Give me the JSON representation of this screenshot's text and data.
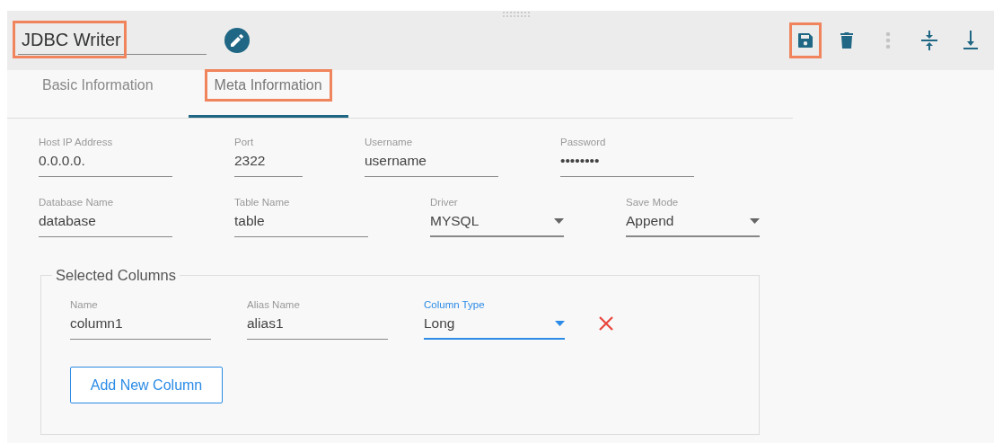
{
  "header": {
    "title": {
      "value": "JDBC Writer",
      "highlighted": true
    },
    "toolbar": [
      {
        "kind": "save",
        "highlighted": true,
        "disabled": false
      },
      {
        "kind": "delete",
        "highlighted": false,
        "disabled": false
      },
      {
        "kind": "more",
        "highlighted": false,
        "disabled": true
      },
      {
        "kind": "collapse",
        "highlighted": false,
        "disabled": false
      },
      {
        "kind": "download",
        "highlighted": false,
        "disabled": false
      }
    ]
  },
  "tabs": [
    {
      "label": "Basic Information",
      "selected": false,
      "highlighted": false
    },
    {
      "label": "Meta Information",
      "selected": true,
      "highlighted": true
    }
  ],
  "form": {
    "rows": [
      [
        {
          "label": "Host IP Address",
          "value": "0.0.0.0.",
          "kind": "text"
        },
        {
          "label": "Port",
          "value": "2322",
          "kind": "text"
        },
        {
          "label": "Username",
          "value": "username",
          "kind": "text"
        },
        {
          "label": "Password",
          "value": "••••••••",
          "kind": "password"
        }
      ],
      [
        {
          "label": "Database Name",
          "value": "database",
          "kind": "text"
        },
        {
          "label": "Table Name",
          "value": "table",
          "kind": "text"
        },
        {
          "label": "Driver",
          "value": "MYSQL",
          "kind": "select"
        },
        {
          "label": "Save Mode",
          "value": "Append",
          "kind": "select"
        }
      ]
    ]
  },
  "selected_columns": {
    "legend": "Selected Columns",
    "rows": [
      [
        {
          "label": "Name",
          "value": "column1",
          "kind": "text",
          "focused": false
        },
        {
          "label": "Alias Name",
          "value": "alias1",
          "kind": "text",
          "focused": false
        },
        {
          "label": "Column Type",
          "value": "Long",
          "kind": "select",
          "focused": true
        }
      ]
    ],
    "add_button": "Add New Column"
  }
}
